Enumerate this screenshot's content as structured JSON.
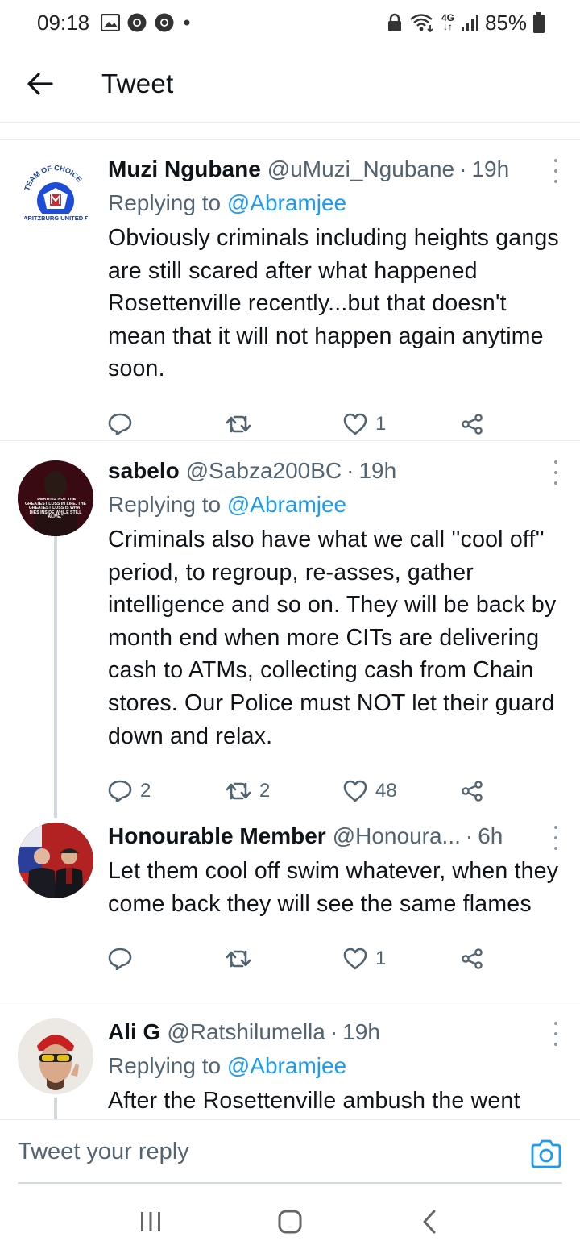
{
  "status_bar": {
    "time": "09:18",
    "network": "4G",
    "battery": "85%",
    "icons": [
      "gallery-icon",
      "chrome-icon",
      "chrome-icon",
      "dot-icon",
      "lock-icon",
      "wifi-icon",
      "signal-icon",
      "battery-icon"
    ]
  },
  "header": {
    "title": "Tweet",
    "back_icon": "back-arrow-icon"
  },
  "tweets": [
    {
      "name": "Muzi Ngubane",
      "handle": "@uMuzi_Ngubane",
      "separator": "·",
      "time": "19h",
      "replying_prefix": "Replying to",
      "replying_to": "@Abramjee",
      "text": "Obviously criminals including heights gangs are still scared after what happened Rosettenville recently...but that doesn't mean that it will not happen again anytime soon.",
      "replies": "",
      "retweets": "",
      "likes": "1",
      "avatar_text": [
        "TEAM OF CHOICE",
        "MARITZBURG UNITED FC"
      ]
    },
    {
      "name": "sabelo",
      "handle": "@Sabza200BC",
      "separator": "·",
      "time": "19h",
      "replying_prefix": "Replying to",
      "replying_to": "@Abramjee",
      "text": "Criminals also have what we call ''cool off'' period, to regroup, re-asses, gather intelligence and so on. They will be back by month end when more CITs are delivering  cash to ATMs, collecting cash from Chain stores. Our Police must NOT let their guard down and relax.",
      "replies": "2",
      "retweets": "2",
      "likes": "48",
      "avatar_text": [
        "\"DEATH IS NOT THE GREATEST LOSS IN LIFE. THE GREATEST LOSS IS WHAT DIES INSIDE WHILE STILL ALIVE.\""
      ]
    },
    {
      "name": "Honourable Member",
      "handle": "@Honoura...",
      "separator": "·",
      "time": "6h",
      "text": "Let them cool off swim whatever, when they come back they will see the same flames",
      "replies": "",
      "retweets": "",
      "likes": "1"
    },
    {
      "name": "Ali G",
      "handle": "@Ratshilumella",
      "separator": "·",
      "time": "19h",
      "replying_prefix": "Replying to",
      "replying_to": "@Abramjee",
      "text": "After the Rosettenville ambush the went"
    }
  ],
  "reply_bar": {
    "placeholder": "Tweet your reply",
    "camera_icon": "camera-icon"
  },
  "nav_bar": {
    "icons": [
      "recents-icon",
      "home-icon",
      "back-icon"
    ]
  },
  "colors": {
    "accent": "#1d9bf0",
    "text": "#0f1419",
    "secondary": "#536471",
    "border": "#e6ecf0"
  }
}
